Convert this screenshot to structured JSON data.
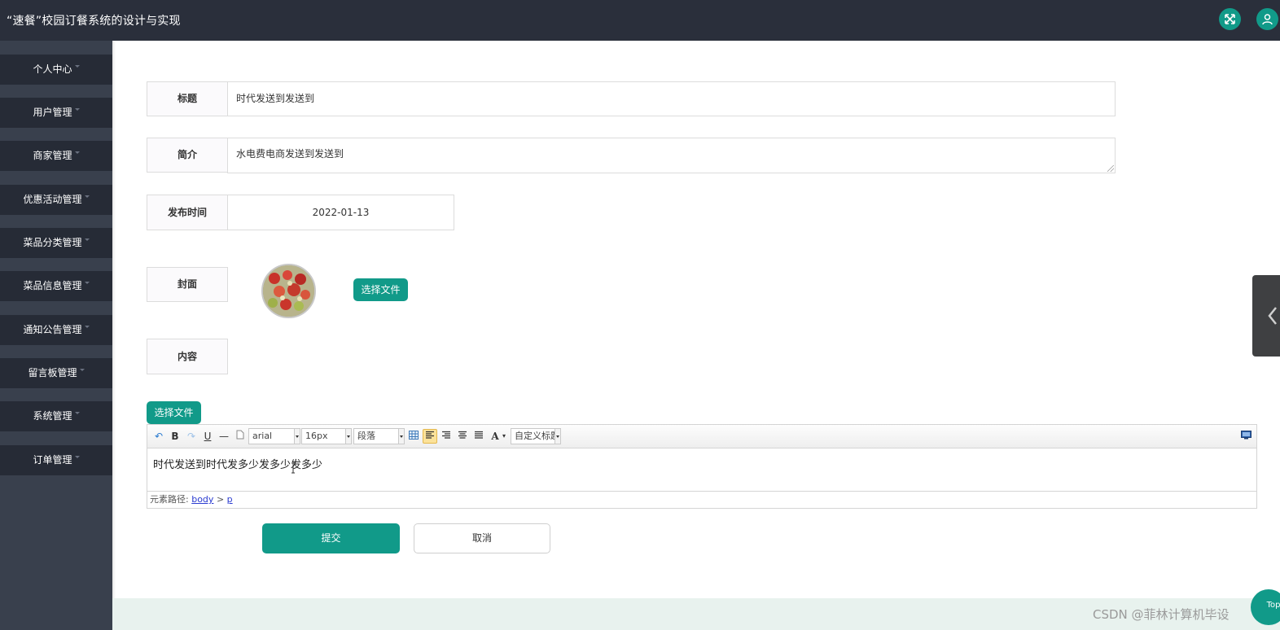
{
  "app": {
    "title": "“速餐”校园订餐系统的设计与实现"
  },
  "topbar": {
    "fullscreen_icon": "expand-icon",
    "user_icon": "user-icon"
  },
  "sidebar": {
    "items": [
      {
        "label": "个人中心"
      },
      {
        "label": "用户管理"
      },
      {
        "label": "商家管理"
      },
      {
        "label": "优惠活动管理"
      },
      {
        "label": "菜品分类管理"
      },
      {
        "label": "菜品信息管理"
      },
      {
        "label": "通知公告管理"
      },
      {
        "label": "留言板管理"
      },
      {
        "label": "系统管理"
      },
      {
        "label": "订单管理"
      }
    ]
  },
  "form": {
    "title_label": "标题",
    "title_value": "时代发送到发送到",
    "intro_label": "简介",
    "intro_value": "水电费电商发送到发送到",
    "publish_time_label": "发布时间",
    "publish_time_value": "2022-01-13",
    "cover_label": "封面",
    "cover_choose_button": "选择文件",
    "content_label": "内容",
    "content_choose_button": "选择文件"
  },
  "editor": {
    "font_family": "arial",
    "font_size": "16px",
    "paragraph": "段落",
    "custom_heading": "自定义标题",
    "body_text": "时代发送到时代发多少发多少发多少",
    "path_label": "元素路径:",
    "path_body": "body",
    "path_sep": ">",
    "path_p": "p"
  },
  "actions": {
    "submit": "提交",
    "cancel": "取消"
  },
  "misc": {
    "back_to_top": "Top",
    "watermark": "CSDN @菲林计算机毕设"
  },
  "colors": {
    "accent": "#119a89",
    "topbar": "#2a2f3b",
    "sidebar": "#39404d",
    "sidebar_item": "#262b36"
  }
}
